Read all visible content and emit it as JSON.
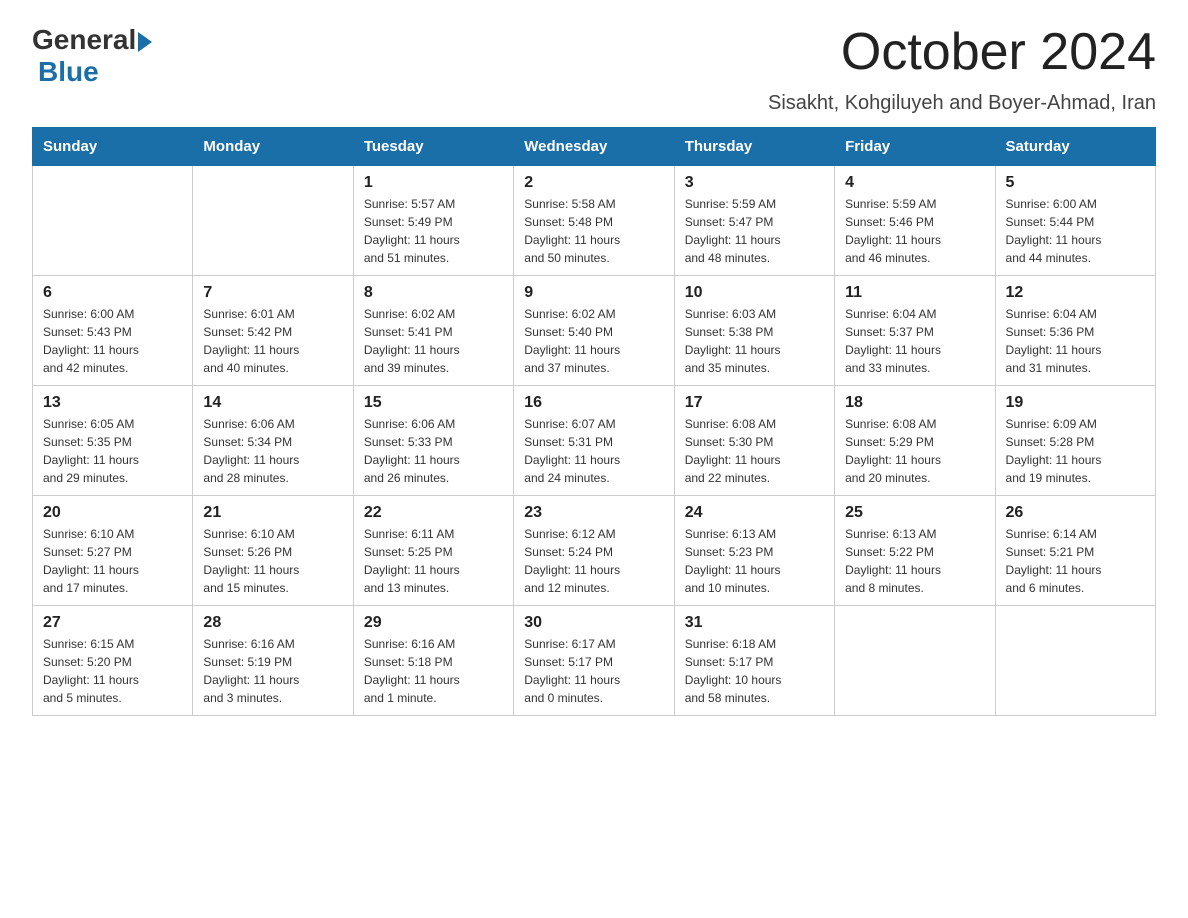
{
  "header": {
    "logo_general": "General",
    "logo_arrow": "▶",
    "logo_blue": "Blue",
    "month_title": "October 2024",
    "location": "Sisakht, Kohgiluyeh and Boyer-Ahmad, Iran"
  },
  "weekdays": [
    "Sunday",
    "Monday",
    "Tuesday",
    "Wednesday",
    "Thursday",
    "Friday",
    "Saturday"
  ],
  "weeks": [
    [
      {
        "day": "",
        "info": ""
      },
      {
        "day": "",
        "info": ""
      },
      {
        "day": "1",
        "info": "Sunrise: 5:57 AM\nSunset: 5:49 PM\nDaylight: 11 hours\nand 51 minutes."
      },
      {
        "day": "2",
        "info": "Sunrise: 5:58 AM\nSunset: 5:48 PM\nDaylight: 11 hours\nand 50 minutes."
      },
      {
        "day": "3",
        "info": "Sunrise: 5:59 AM\nSunset: 5:47 PM\nDaylight: 11 hours\nand 48 minutes."
      },
      {
        "day": "4",
        "info": "Sunrise: 5:59 AM\nSunset: 5:46 PM\nDaylight: 11 hours\nand 46 minutes."
      },
      {
        "day": "5",
        "info": "Sunrise: 6:00 AM\nSunset: 5:44 PM\nDaylight: 11 hours\nand 44 minutes."
      }
    ],
    [
      {
        "day": "6",
        "info": "Sunrise: 6:00 AM\nSunset: 5:43 PM\nDaylight: 11 hours\nand 42 minutes."
      },
      {
        "day": "7",
        "info": "Sunrise: 6:01 AM\nSunset: 5:42 PM\nDaylight: 11 hours\nand 40 minutes."
      },
      {
        "day": "8",
        "info": "Sunrise: 6:02 AM\nSunset: 5:41 PM\nDaylight: 11 hours\nand 39 minutes."
      },
      {
        "day": "9",
        "info": "Sunrise: 6:02 AM\nSunset: 5:40 PM\nDaylight: 11 hours\nand 37 minutes."
      },
      {
        "day": "10",
        "info": "Sunrise: 6:03 AM\nSunset: 5:38 PM\nDaylight: 11 hours\nand 35 minutes."
      },
      {
        "day": "11",
        "info": "Sunrise: 6:04 AM\nSunset: 5:37 PM\nDaylight: 11 hours\nand 33 minutes."
      },
      {
        "day": "12",
        "info": "Sunrise: 6:04 AM\nSunset: 5:36 PM\nDaylight: 11 hours\nand 31 minutes."
      }
    ],
    [
      {
        "day": "13",
        "info": "Sunrise: 6:05 AM\nSunset: 5:35 PM\nDaylight: 11 hours\nand 29 minutes."
      },
      {
        "day": "14",
        "info": "Sunrise: 6:06 AM\nSunset: 5:34 PM\nDaylight: 11 hours\nand 28 minutes."
      },
      {
        "day": "15",
        "info": "Sunrise: 6:06 AM\nSunset: 5:33 PM\nDaylight: 11 hours\nand 26 minutes."
      },
      {
        "day": "16",
        "info": "Sunrise: 6:07 AM\nSunset: 5:31 PM\nDaylight: 11 hours\nand 24 minutes."
      },
      {
        "day": "17",
        "info": "Sunrise: 6:08 AM\nSunset: 5:30 PM\nDaylight: 11 hours\nand 22 minutes."
      },
      {
        "day": "18",
        "info": "Sunrise: 6:08 AM\nSunset: 5:29 PM\nDaylight: 11 hours\nand 20 minutes."
      },
      {
        "day": "19",
        "info": "Sunrise: 6:09 AM\nSunset: 5:28 PM\nDaylight: 11 hours\nand 19 minutes."
      }
    ],
    [
      {
        "day": "20",
        "info": "Sunrise: 6:10 AM\nSunset: 5:27 PM\nDaylight: 11 hours\nand 17 minutes."
      },
      {
        "day": "21",
        "info": "Sunrise: 6:10 AM\nSunset: 5:26 PM\nDaylight: 11 hours\nand 15 minutes."
      },
      {
        "day": "22",
        "info": "Sunrise: 6:11 AM\nSunset: 5:25 PM\nDaylight: 11 hours\nand 13 minutes."
      },
      {
        "day": "23",
        "info": "Sunrise: 6:12 AM\nSunset: 5:24 PM\nDaylight: 11 hours\nand 12 minutes."
      },
      {
        "day": "24",
        "info": "Sunrise: 6:13 AM\nSunset: 5:23 PM\nDaylight: 11 hours\nand 10 minutes."
      },
      {
        "day": "25",
        "info": "Sunrise: 6:13 AM\nSunset: 5:22 PM\nDaylight: 11 hours\nand 8 minutes."
      },
      {
        "day": "26",
        "info": "Sunrise: 6:14 AM\nSunset: 5:21 PM\nDaylight: 11 hours\nand 6 minutes."
      }
    ],
    [
      {
        "day": "27",
        "info": "Sunrise: 6:15 AM\nSunset: 5:20 PM\nDaylight: 11 hours\nand 5 minutes."
      },
      {
        "day": "28",
        "info": "Sunrise: 6:16 AM\nSunset: 5:19 PM\nDaylight: 11 hours\nand 3 minutes."
      },
      {
        "day": "29",
        "info": "Sunrise: 6:16 AM\nSunset: 5:18 PM\nDaylight: 11 hours\nand 1 minute."
      },
      {
        "day": "30",
        "info": "Sunrise: 6:17 AM\nSunset: 5:17 PM\nDaylight: 11 hours\nand 0 minutes."
      },
      {
        "day": "31",
        "info": "Sunrise: 6:18 AM\nSunset: 5:17 PM\nDaylight: 10 hours\nand 58 minutes."
      },
      {
        "day": "",
        "info": ""
      },
      {
        "day": "",
        "info": ""
      }
    ]
  ]
}
